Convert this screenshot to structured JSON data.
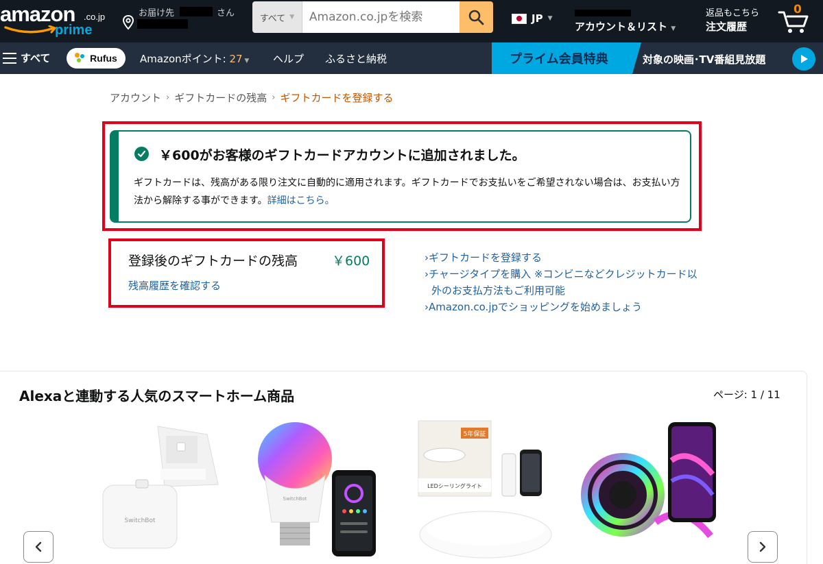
{
  "header": {
    "logo_word": "amazon",
    "logo_suffix": ".co.jp",
    "logo_prime": "prime",
    "deliver_label": "お届け先",
    "deliver_suffix": "さん",
    "search_category": "すべて",
    "search_placeholder": "Amazon.co.jpを検索",
    "language": "JP",
    "account_label": "アカウント＆リスト",
    "orders_top": "返品もこちら",
    "orders_bottom": "注文履歴",
    "cart_count": "0"
  },
  "nav": {
    "all": "すべて",
    "rufus": "Rufus",
    "points_label": "Amazonポイント: ",
    "points_value": "27",
    "help": "ヘルプ",
    "furusato": "ふるさと納税",
    "prime_badge": "プライム会員特典",
    "prime_text": "対象の映画･TV番組見放題"
  },
  "breadcrumb": {
    "account": "アカウント",
    "balance": "ギフトカードの残高",
    "current": "ギフトカードを登録する",
    "separator": "›"
  },
  "alert": {
    "title": "￥600がお客様のギフトカードアカウントに追加されました。",
    "body": "ギフトカードは、残高がある限り注文に自動的に適用されます。ギフトカードでお支払いをご希望されない場合は、お支払い方法から解除する事ができます。",
    "link": "詳細はこちら。"
  },
  "balance": {
    "label": "登録後のギフトカードの残高",
    "amount": "￥600",
    "history_link": "残高履歴を確認する"
  },
  "quick_links": [
    "›ギフトカードを登録する",
    "›チャージタイプを購入 ※コンビニなどクレジットカード以外のお支払方法もご利用可能",
    "›Amazon.co.jpでショッピングを始めましょう"
  ],
  "carousel": {
    "title": "Alexaと連動する人気のスマートホーム商品",
    "page": "ページ: 1 / 11",
    "products": [
      {
        "name": "SwitchBot",
        "overlay": ""
      },
      {
        "name": "SwitchBot",
        "overlay": ""
      },
      {
        "name": "LEDシーリングライト",
        "overlay": "5年保証"
      },
      {
        "name": "",
        "overlay": ""
      }
    ]
  },
  "colors": {
    "nav_belt": "#131921",
    "nav_main": "#232f3e",
    "search_button": "#febd69",
    "prime_blue": "#00a8e1",
    "success_green": "#067d62",
    "link_blue": "#2162a1",
    "highlight_red": "#e4001b",
    "breadcrumb_current": "#c45500"
  }
}
